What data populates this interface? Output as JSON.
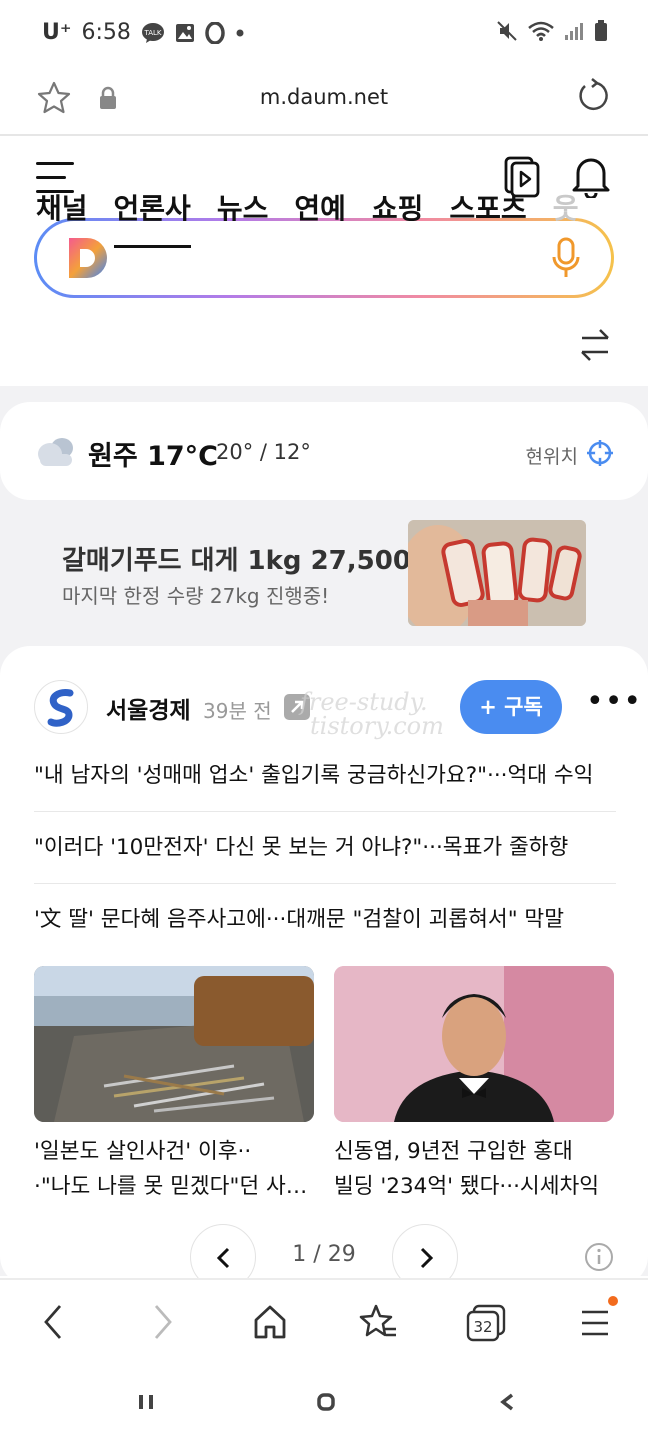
{
  "status_bar": {
    "carrier": "U⁺",
    "time": "6:58",
    "badge": "TALK"
  },
  "browser": {
    "url": "m.daum.net",
    "tab_count": "32"
  },
  "header": {
    "tabs": [
      "채널",
      "언론사",
      "뉴스",
      "연예",
      "쇼핑",
      "스포츠",
      "웃"
    ],
    "active_tab": "언론사",
    "search_placeholder": ""
  },
  "weather": {
    "city_temp": "원주 17°C",
    "range": "20° / 12°",
    "location_label": "현위치"
  },
  "ad": {
    "title": "갈매기푸드 대게 1kg 27,500",
    "subtitle": "마지막 한정 수량 27kg 진행중!"
  },
  "news": {
    "press_name": "서울경제",
    "time_ago": "39분 전",
    "subscribe_label": "+ 구독",
    "headlines": [
      "\"내 남자의 '성매매 업소' 출입기록 궁금하신가요?\"···억대 수익",
      "\"이러다 '10만전자' 다신 못 보는 거 아냐?\"···목표가 줄하향",
      "'文 딸' 문다혜 음주사고에···대깨문 \"검찰이 괴롭혀서\" 막말"
    ],
    "cards": [
      {
        "line1": "'일본도 살인사건' 이후··",
        "line2": "·\"나도 나를 못 믿겠다\"던 사람들"
      },
      {
        "line1": "신동엽, 9년전 구입한 홍대",
        "line2": "빌딩 '234억' 됐다···시세차익"
      }
    ],
    "pager": "1 / 29"
  },
  "watermark": {
    "line1": "free-study.",
    "line2": "tistory.com"
  },
  "colors": {
    "accent": "#4a8cf0",
    "search_gradient": [
      "#5b8cf5",
      "#b27be8",
      "#f08aa3",
      "#f5c24b"
    ],
    "notification_dot": "#f26b1d"
  }
}
